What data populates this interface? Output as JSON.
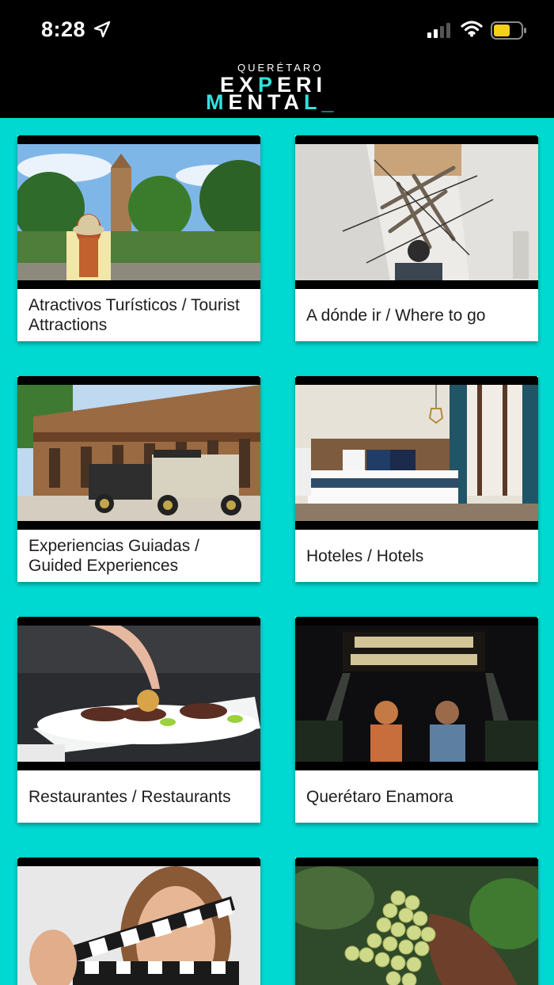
{
  "status_bar": {
    "time": "8:28",
    "icons": [
      "location-arrow-icon",
      "cellular-signal-icon",
      "wifi-icon",
      "battery-icon"
    ],
    "battery_color": "#f5d01a"
  },
  "header": {
    "logo": {
      "line1": "QUERÉTARO",
      "line2_parts": [
        "EX",
        "P",
        "ERI"
      ],
      "line3_parts": [
        "M",
        "ENTA",
        "L_"
      ]
    }
  },
  "colors": {
    "background": "#00d9d2",
    "header": "#000000",
    "accent": "#2fe4dc"
  },
  "cards": [
    {
      "label": "Atractivos Turísticos / Tourist Attractions",
      "image": "tourist-attractions-photo"
    },
    {
      "label": "A dónde ir / Where to go",
      "image": "art-installation-photo"
    },
    {
      "label": "Experiencias Guiadas / Guided Experiences",
      "image": "vintage-cars-photo"
    },
    {
      "label": "Hoteles / Hotels",
      "image": "hotel-room-photo"
    },
    {
      "label": "Restaurantes / Restaurants",
      "image": "restaurant-dish-photo"
    },
    {
      "label": "Querétaro Enamora",
      "image": "couple-lights-photo"
    },
    {
      "label": "",
      "image": "clapperboard-photo"
    },
    {
      "label": "",
      "image": "grapes-photo"
    }
  ]
}
